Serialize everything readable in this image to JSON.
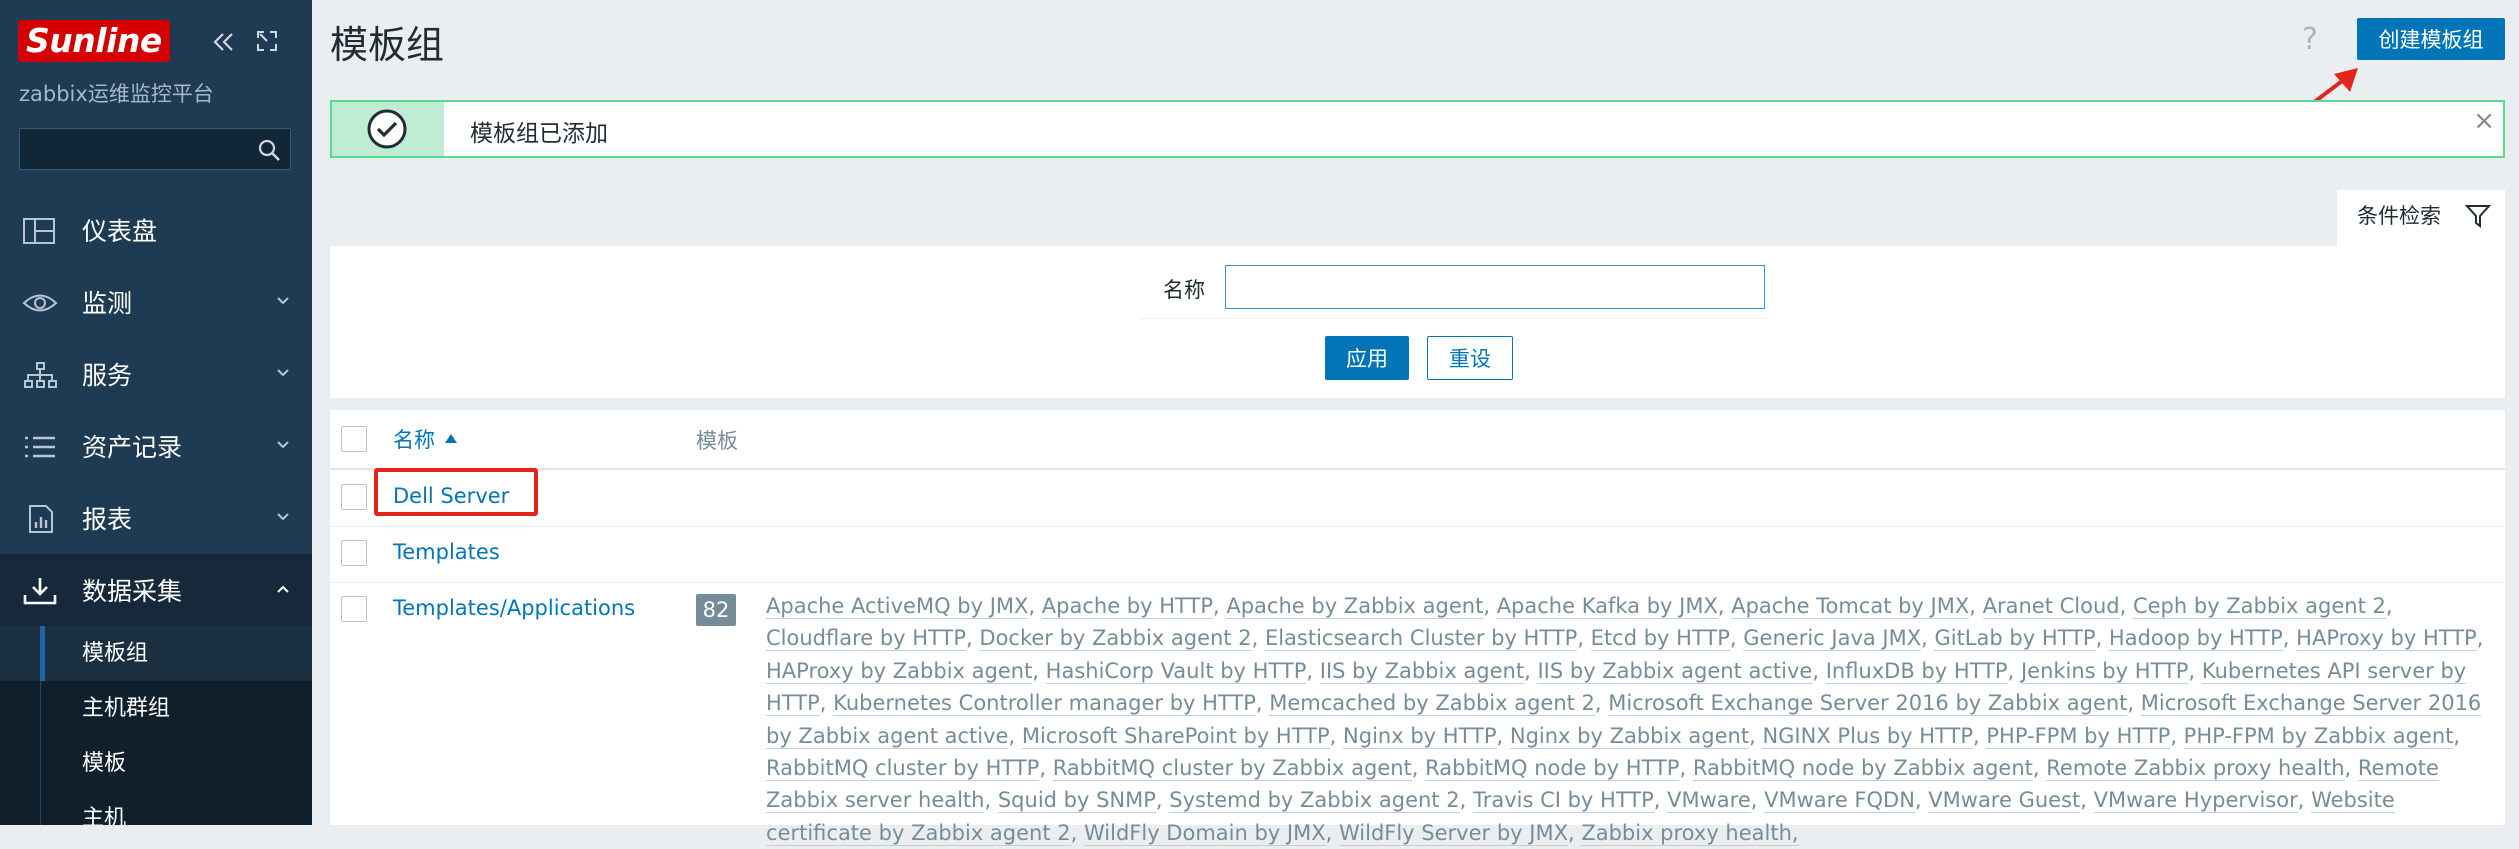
{
  "brand": {
    "logo_text": "Sunline",
    "subtitle": "zabbix运维监控平台",
    "logo_color": "#d40000"
  },
  "sidebar": {
    "search": {
      "placeholder": "",
      "value": ""
    },
    "menu": [
      {
        "label": "仪表盘",
        "icon": "dashboard-icon",
        "expanded": false,
        "has_chevron": false
      },
      {
        "label": "监测",
        "icon": "eye-icon",
        "expanded": false,
        "has_chevron": true
      },
      {
        "label": "服务",
        "icon": "services-icon",
        "expanded": false,
        "has_chevron": true
      },
      {
        "label": "资产记录",
        "icon": "inventory-list-icon",
        "expanded": false,
        "has_chevron": true
      },
      {
        "label": "报表",
        "icon": "reports-icon",
        "expanded": false,
        "has_chevron": true
      },
      {
        "label": "数据采集",
        "icon": "download-icon",
        "expanded": true,
        "has_chevron": true
      }
    ],
    "submenu": [
      {
        "label": "模板组",
        "selected": true
      },
      {
        "label": "主机群组",
        "selected": false
      },
      {
        "label": "模板",
        "selected": false
      },
      {
        "label": "主机",
        "selected": false
      }
    ]
  },
  "header": {
    "title": "模板组",
    "help": "?",
    "create_button": "创建模板组"
  },
  "message": {
    "text": "模板组已添加",
    "close": "×",
    "type": "success"
  },
  "filter": {
    "tab_label": "条件检索",
    "name_label": "名称",
    "name_value": "",
    "apply": "应用",
    "reset": "重设"
  },
  "table": {
    "columns": {
      "name": "名称",
      "templates": "模板"
    },
    "sort": {
      "column": "name",
      "direction": "asc"
    },
    "rows": [
      {
        "name": "Dell Server",
        "count": "",
        "highlighted": true
      },
      {
        "name": "Templates",
        "count": "",
        "highlighted": false
      },
      {
        "name": "Templates/Applications",
        "count": "82",
        "highlighted": false
      }
    ],
    "app_templates": [
      "Apache ActiveMQ by JMX",
      "Apache by HTTP",
      "Apache by Zabbix agent",
      "Apache Kafka by JMX",
      "Apache Tomcat by JMX",
      "Aranet Cloud",
      "Ceph by Zabbix agent 2",
      "Cloudflare by HTTP",
      "Docker by Zabbix agent 2",
      "Elasticsearch Cluster by HTTP",
      "Etcd by HTTP",
      "Generic Java JMX",
      "GitLab by HTTP",
      "Hadoop by HTTP",
      "HAProxy by HTTP",
      "HAProxy by Zabbix agent",
      "HashiCorp Vault by HTTP",
      "IIS by Zabbix agent",
      "IIS by Zabbix agent active",
      "InfluxDB by HTTP",
      "Jenkins by HTTP",
      "Kubernetes API server by HTTP",
      "Kubernetes Controller manager by HTTP",
      "Memcached by Zabbix agent 2",
      "Microsoft Exchange Server 2016 by Zabbix agent",
      "Microsoft Exchange Server 2016 by Zabbix agent active",
      "Microsoft SharePoint by HTTP",
      "Nginx by HTTP",
      "Nginx by Zabbix agent",
      "NGINX Plus by HTTP",
      "PHP-FPM by HTTP",
      "PHP-FPM by Zabbix agent",
      "RabbitMQ cluster by HTTP",
      "RabbitMQ cluster by Zabbix agent",
      "RabbitMQ node by HTTP",
      "RabbitMQ node by Zabbix agent",
      "Remote Zabbix proxy health",
      "Remote Zabbix server health",
      "Squid by SNMP",
      "Systemd by Zabbix agent 2",
      "Travis CI by HTTP",
      "VMware",
      "VMware FQDN",
      "VMware Guest",
      "VMware Hypervisor",
      "Website certificate by Zabbix agent 2",
      "WildFly Domain by JMX",
      "WildFly Server by JMX",
      "Zabbix proxy health,"
    ]
  },
  "colors": {
    "sidebar_bg": "#1f3a53",
    "accent": "#0275b8",
    "success": "#59db8f",
    "annotation": "#e5241c"
  }
}
